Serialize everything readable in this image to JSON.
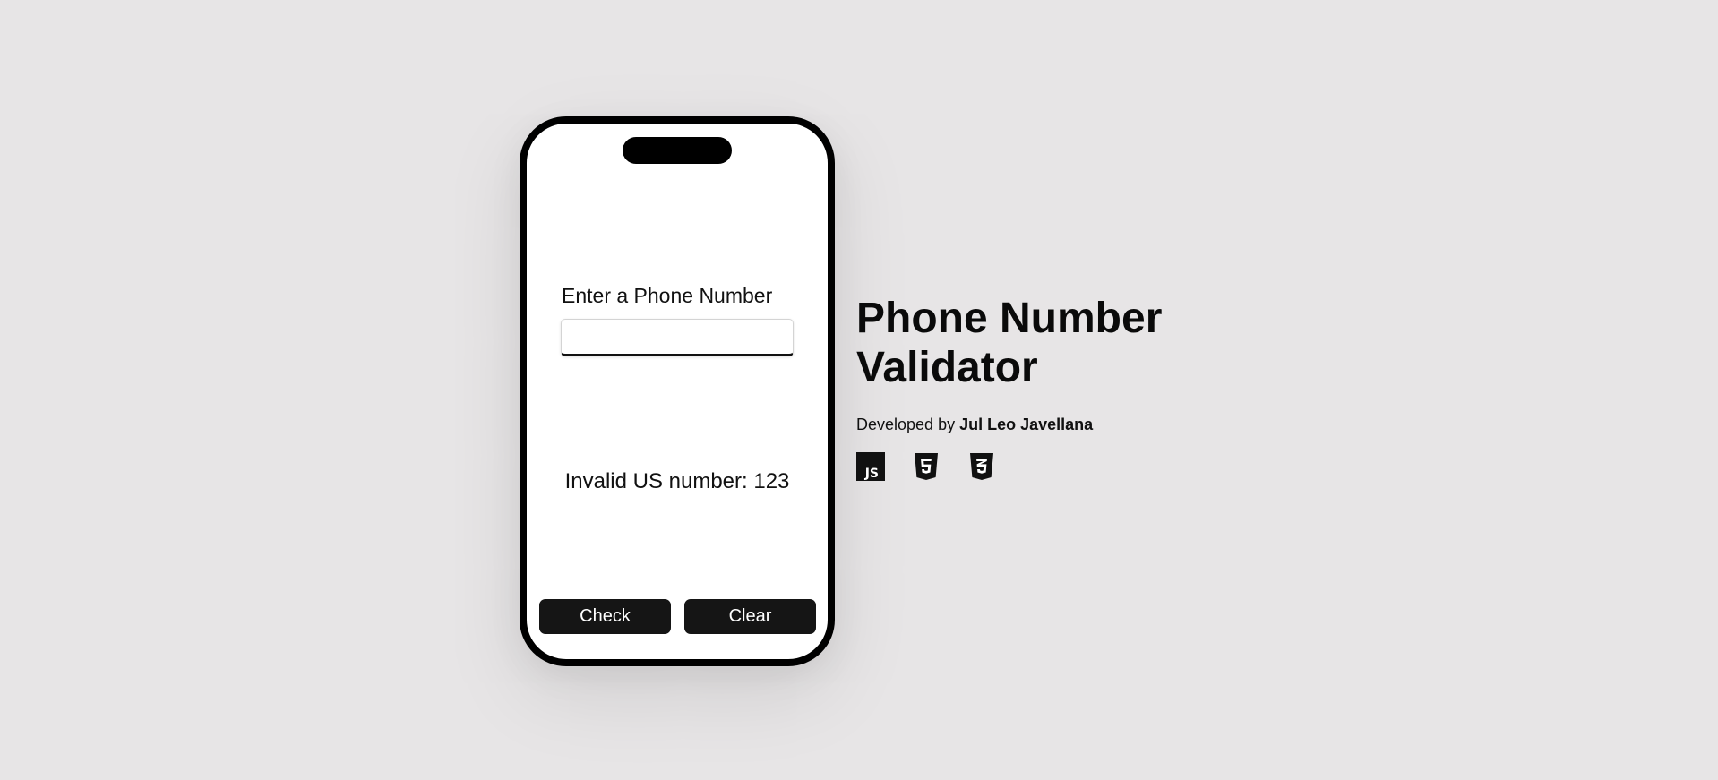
{
  "phone": {
    "input_label": "Enter a Phone Number",
    "input_value": "",
    "input_placeholder": "",
    "result_text": "Invalid US number: 123",
    "check_label": "Check",
    "clear_label": "Clear"
  },
  "info": {
    "title": "Phone Number Validator",
    "credit_prefix": "Developed by ",
    "author": "Jul Leo Javellana",
    "tech_icons": [
      "javascript-icon",
      "html5-icon",
      "css3-icon"
    ]
  },
  "colors": {
    "background": "#e7e5e6",
    "phone_frame": "#000000",
    "button": "#151515",
    "button_text": "#ffffff"
  }
}
